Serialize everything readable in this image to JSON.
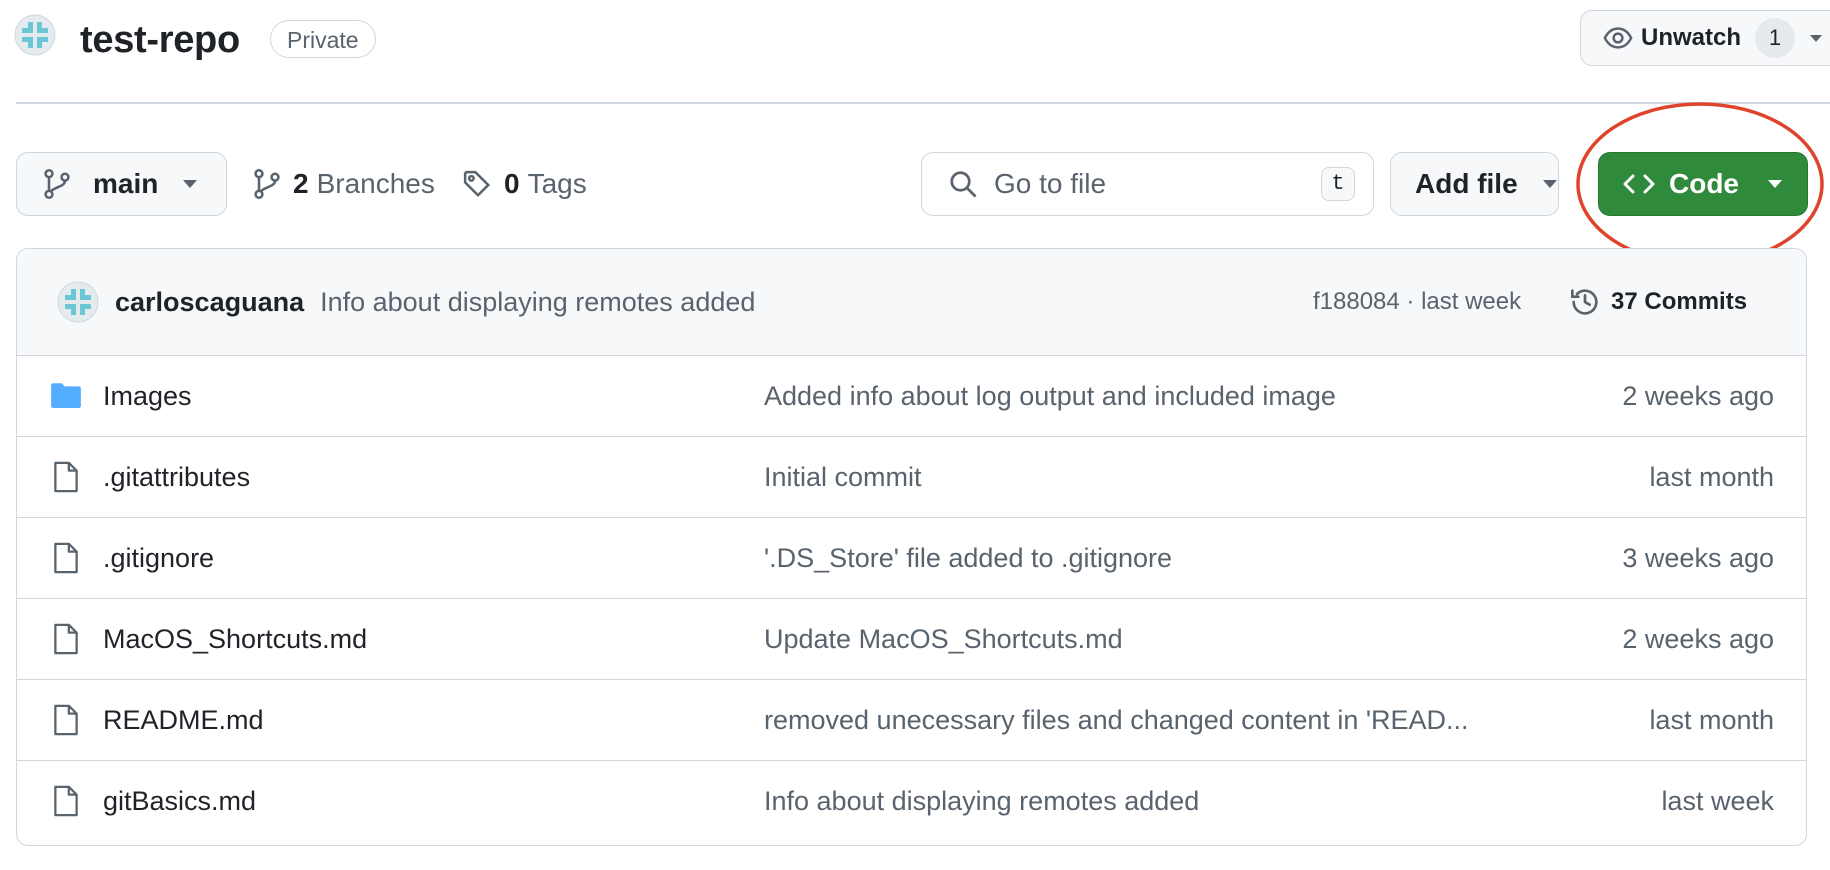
{
  "repo": {
    "name": "test-repo",
    "visibility": "Private",
    "avatar_icon": "identicon-avatar",
    "unwatch_label": "Unwatch",
    "watch_count": "1"
  },
  "toolbar": {
    "branch": "main",
    "branches_count": "2",
    "branches_label": "Branches",
    "tags_count": "0",
    "tags_label": "Tags",
    "goto_placeholder": "Go to file",
    "goto_shortcut": "t",
    "add_file_label": "Add file",
    "code_label": "Code"
  },
  "colors": {
    "code_button": "#2f8a3c",
    "highlight_ring": "#e0432c",
    "folder_icon": "#54aeff"
  },
  "latest_commit": {
    "author": "carloscaguana",
    "message": "Info about displaying remotes added",
    "meta": "f188084 · last week",
    "commits_label": "37 Commits"
  },
  "files": [
    {
      "name": "Images",
      "type": "folder",
      "message": "Added info about log output and included image",
      "date": "2 weeks ago"
    },
    {
      "name": ".gitattributes",
      "type": "file",
      "message": "Initial commit",
      "date": "last month"
    },
    {
      "name": ".gitignore",
      "type": "file",
      "message": "'.DS_Store' file added to .gitignore",
      "date": "3 weeks ago"
    },
    {
      "name": "MacOS_Shortcuts.md",
      "type": "file",
      "message": "Update MacOS_Shortcuts.md",
      "date": "2 weeks ago"
    },
    {
      "name": "README.md",
      "type": "file",
      "message": "removed unecessary files and changed content in 'READ...",
      "date": "last month"
    },
    {
      "name": "gitBasics.md",
      "type": "file",
      "message": "Info about displaying remotes added",
      "date": "last week"
    }
  ]
}
